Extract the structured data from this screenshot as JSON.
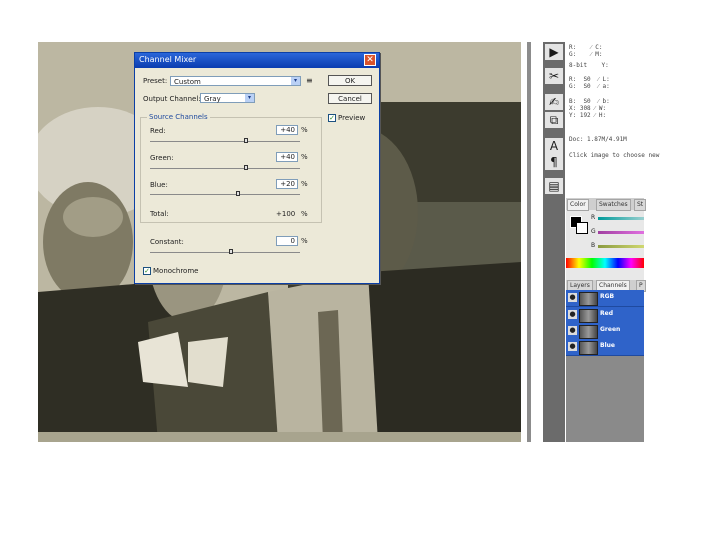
{
  "dialog": {
    "title": "Channel Mixer",
    "close_glyph": "✕",
    "preset_label": "Preset:",
    "preset_value": "Custom",
    "output_label": "Output Channel:",
    "output_value": "Gray",
    "source_label": "Source Channels",
    "red_label": "Red:",
    "red_value": "+40",
    "green_label": "Green:",
    "green_value": "+40",
    "blue_label": "Blue:",
    "blue_value": "+20",
    "total_label": "Total:",
    "total_value": "+100",
    "constant_label": "Constant:",
    "constant_value": "0",
    "percent": "%",
    "ok_label": "OK",
    "cancel_label": "Cancel",
    "preview_label": "Preview",
    "monochrome_label": "Monochrome",
    "check_glyph": "✓",
    "dropdown_glyph": "▾",
    "menu_glyph": "≡"
  },
  "tools": [
    {
      "icon": "▶",
      "name": "move-tool-icon"
    },
    {
      "icon": "✂",
      "name": "crop-tool-icon"
    },
    {
      "icon": "✍",
      "name": "brush-tool-icon"
    },
    {
      "icon": "⧉",
      "name": "stamp-tool-icon"
    },
    {
      "icon": "A",
      "name": "type-tool-icon"
    },
    {
      "icon": "¶",
      "name": "paragraph-tool-icon"
    },
    {
      "icon": "▤",
      "name": "notes-tool-icon"
    }
  ],
  "info": {
    "row1": "R:    ⁄ C:",
    "row2": "G:    ⁄ M:",
    "row3": "8-bit    Y:",
    "row4": "R:  S0  ⁄ L:",
    "row5": "G:  S0  ⁄ a:",
    "row6": "B:  S0  ⁄ b:",
    "row7": "X: 308 ⁄ W:",
    "row8": "Y: 192 ⁄ H:",
    "doc": "Doc: 1.87M/4.91M",
    "hint": "Click image to choose new"
  },
  "color_panel": {
    "tab_color": "Color",
    "tab_swatches": "Swatches",
    "tab_styles": "St",
    "r": "R",
    "g": "G",
    "b": "B"
  },
  "channels_panel": {
    "tab_layers": "Layers",
    "tab_channels": "Channels",
    "tab_paths": "P",
    "eye_glyph": "●",
    "rows": [
      {
        "label": "RGB"
      },
      {
        "label": "Red"
      },
      {
        "label": "Green"
      },
      {
        "label": "Blue"
      }
    ]
  },
  "colors": {
    "titlebar": "#0a3cb0",
    "channel_row": "#2f63c9",
    "photo_tone": "#bdb8a4"
  }
}
